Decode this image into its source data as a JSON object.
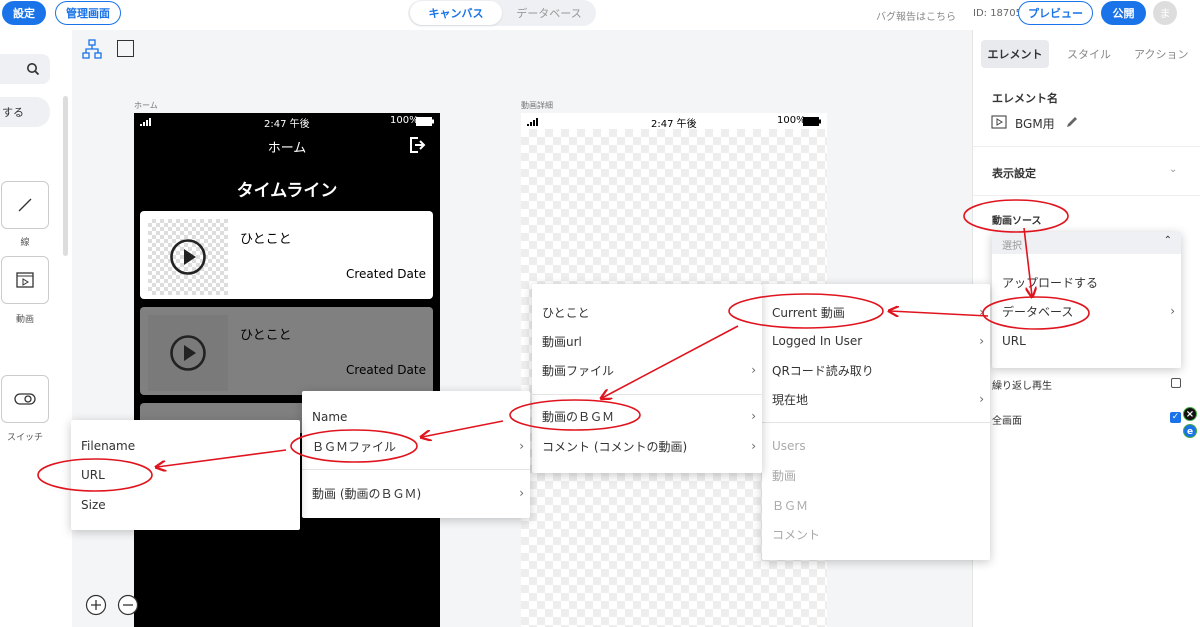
{
  "topbar": {
    "settings": "設定",
    "admin": "管理画面",
    "tab_canvas": "キャンバス",
    "tab_database": "データベース",
    "bug_report": "バグ報告はこちら",
    "app_id": "ID: 18705",
    "preview": "プレビュー",
    "publish": "公開",
    "avatar": "ま"
  },
  "left": {
    "pill_text": "する",
    "tool_line": "線",
    "tool_video": "動画",
    "tool_switch": "スイッチ"
  },
  "home_screen": {
    "label": "ホーム",
    "time": "2:47 午後",
    "battery": "100%",
    "nav_title": "ホーム",
    "heading": "タイムライン",
    "cards": [
      {
        "title": "ひとこと",
        "date": "Created Date"
      },
      {
        "title": "ひとこと",
        "date": "Created Date"
      }
    ]
  },
  "detail_screen": {
    "label": "動画詳細",
    "time": "2:47 午後",
    "battery": "100%"
  },
  "right": {
    "tabs": [
      "エレメント",
      "スタイル",
      "アクション"
    ],
    "element_name_label": "エレメント名",
    "element_name": "BGM用",
    "display_settings": "表示設定",
    "video_source": "動画ソース",
    "select_placeholder": "選択",
    "loop": "繰り返し再生",
    "fullscreen": "全画面"
  },
  "menus": {
    "source": [
      "アップロードする",
      "データベース",
      "URL"
    ],
    "current": {
      "items": [
        "Current 動画",
        "Logged In User",
        "QRコード読み取り",
        "現在地"
      ],
      "disabled": [
        "Users",
        "動画",
        "ＢＧＭ",
        "コメント"
      ]
    },
    "fields": [
      "ひとこと",
      "動画url",
      "動画ファイル",
      "動画のＢＧＭ",
      "コメント (コメントの動画)"
    ],
    "bgm": [
      "Name",
      "ＢＧＭファイル",
      "動画 (動画のＢＧＭ)"
    ],
    "file": [
      "Filename",
      "URL",
      "Size"
    ]
  },
  "colors": {
    "accent": "#1a73e8",
    "annotation": "#e0141e"
  }
}
